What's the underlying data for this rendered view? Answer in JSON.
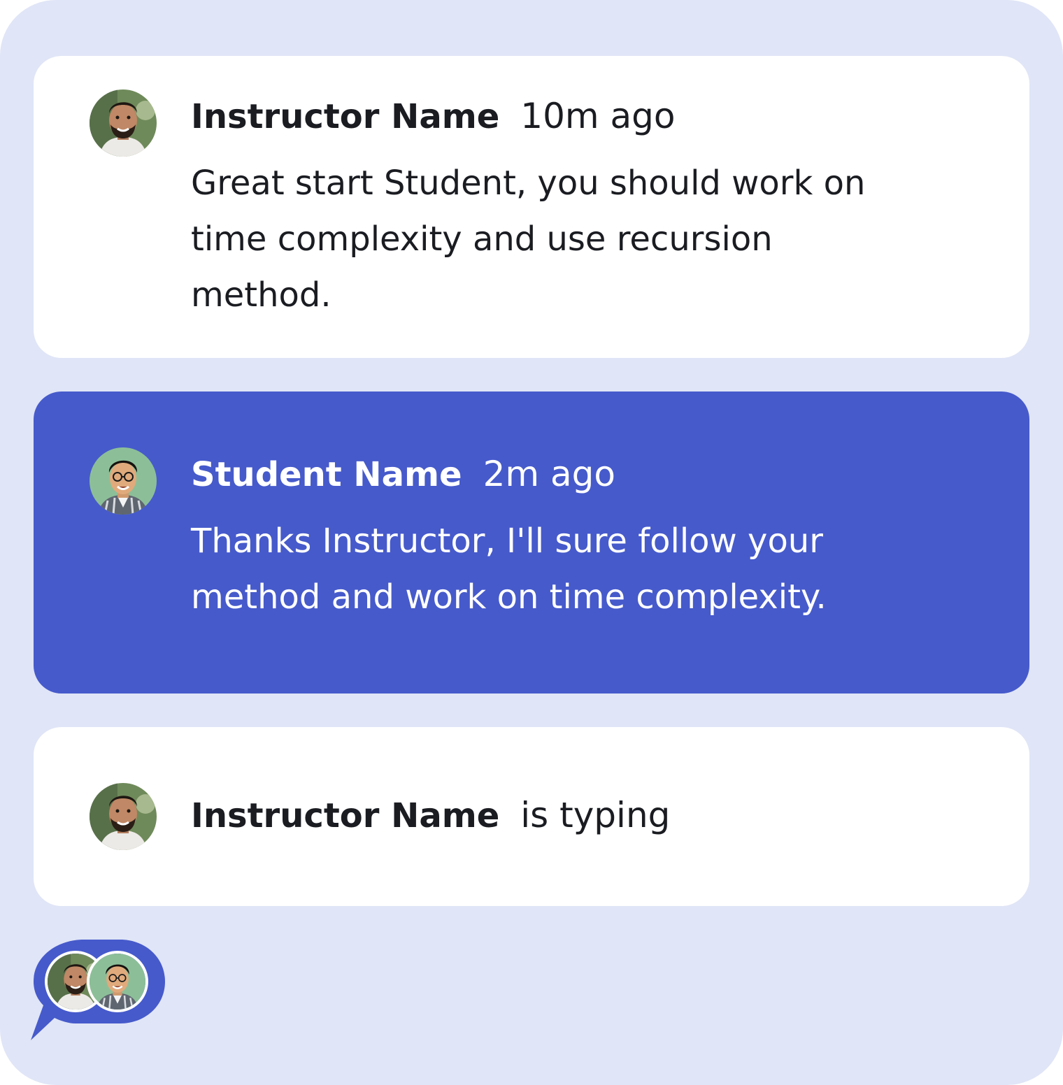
{
  "messages": [
    {
      "sender": "Instructor Name",
      "time": "10m ago",
      "lines": [
        "Great start Student, you should work on",
        "time complexity and use recursion",
        "method."
      ],
      "avatar_icon": "instructor-avatar"
    },
    {
      "sender": "Student Name",
      "time": "2m ago",
      "lines": [
        "Thanks Instructor, I'll sure follow your",
        "method and work on time complexity."
      ],
      "avatar_icon": "student-avatar"
    }
  ],
  "typing": {
    "sender": "Instructor Name",
    "status": "is typing",
    "avatar_icon": "instructor-avatar"
  },
  "badge": {
    "icon": "chat-participants-icon"
  },
  "colors": {
    "page_background": "#e0e5f7",
    "card_background": "#ffffff",
    "student_card_background": "#465acb",
    "text_dark": "#1a1c22",
    "text_light": "#ffffff"
  }
}
